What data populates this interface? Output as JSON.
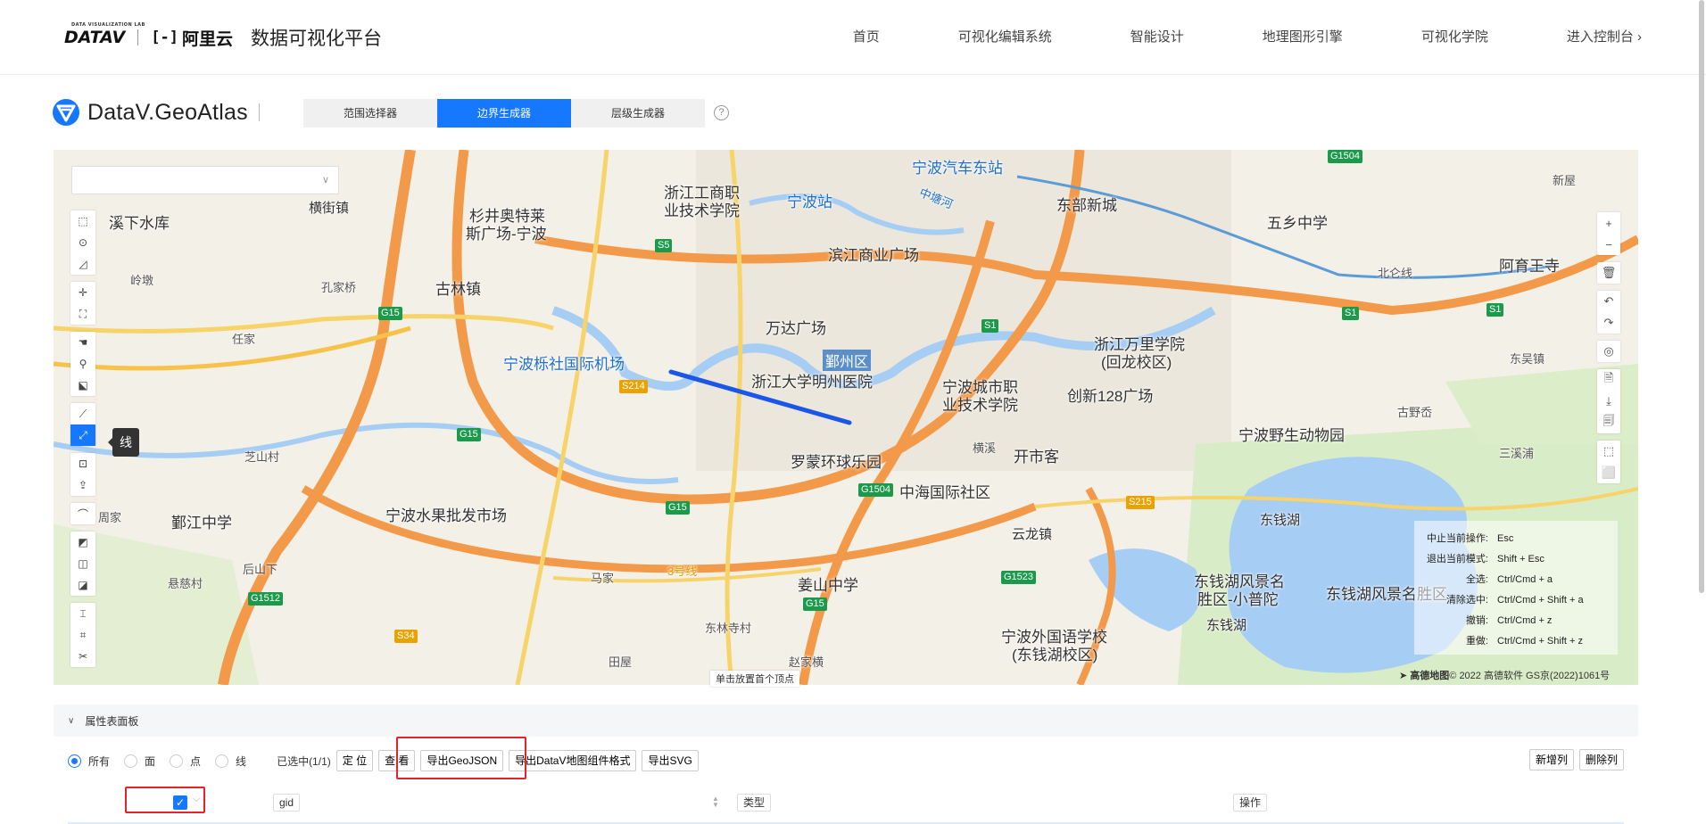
{
  "header": {
    "logo_datav": "DATAV",
    "logo_datav_sub": "DATA VISUALIZATION LAB",
    "logo_aliyun": "阿里云",
    "platform_title": "数据可视化平台",
    "nav": [
      "首页",
      "可视化编辑系统",
      "智能设计",
      "地理图形引擎",
      "可视化学院",
      "进入控制台 ›"
    ]
  },
  "tool": {
    "title": "DataV.GeoAtlas",
    "tabs": [
      "范围选择器",
      "边界生成器",
      "层级生成器"
    ],
    "active_tab": 1,
    "help_icon": "?"
  },
  "map": {
    "labels": {
      "l1": "溪下水库",
      "l2": "横街镇",
      "l3": "杉井奥特莱",
      "l3b": "斯广场-宁波",
      "l4": "浙江工商职",
      "l4b": "业技术学院",
      "l5": "宁波站",
      "l6": "宁波汽车东站",
      "l7": "东部新城",
      "l8": "五乡中学",
      "l9": "古林镇",
      "l10": "滨江商业广场",
      "l11": "宁波栎社国际机场",
      "l12": "万达广场",
      "l13": "鄞州区",
      "l14": "浙江大学明州医院",
      "l15": "宁波城市职",
      "l15b": "业技术学院",
      "l16": "创新128广场",
      "l17": "浙江万里学院",
      "l17b": "(回龙校区)",
      "l18": "阿育王寺",
      "l19": "宁波野生动物园",
      "l20": "罗蒙环球乐园",
      "l21": "开市客",
      "l22": "中海国际社区",
      "l23": "宁波水果批发市场",
      "l24": "鄞江中学",
      "l25": "云龙镇",
      "l26": "东钱湖",
      "l27": "东钱湖风景名",
      "l27b": "胜区-小普陀",
      "l28": "东钱湖风景名胜区",
      "l29": "姜山中学",
      "l30": "宁波外国语学校",
      "l30b": "(东钱湖校区)",
      "l31": "东钱湖",
      "l32": "岭墩",
      "l33": "孔家桥",
      "l34": "任家",
      "l35": "芝山村",
      "l36": "周家",
      "l37": "悬慈村",
      "l38": "后山下",
      "l39": "东吴镇",
      "l40": "中塘河",
      "l41": "北仑线",
      "l42": "新屋",
      "l43": "三溪浦",
      "l44": "古野岙",
      "l45": "横溪",
      "l46": "3号线",
      "l47": "马家",
      "l48": "东林寺村",
      "l49": "田屋",
      "l50": "赵家横"
    },
    "roads": [
      "G15",
      "G15",
      "G15",
      "G15",
      "S5",
      "S1",
      "S1",
      "S214",
      "G1504",
      "S215",
      "G1523",
      "G1512",
      "S34",
      "G1504",
      "S1"
    ],
    "line_tooltip": "线",
    "hint": "单击放置首个顶点",
    "credit_brand": "高德地图",
    "credit_text": "© 2022 高德软件 GS京(2022)1061号"
  },
  "shortcuts": [
    {
      "key": "中止当前操作:",
      "val": "Esc"
    },
    {
      "key": "退出当前模式:",
      "val": "Shift + Esc"
    },
    {
      "key": "全选:",
      "val": "Ctrl/Cmd + a"
    },
    {
      "key": "清除选中:",
      "val": "Ctrl/Cmd + Shift + a"
    },
    {
      "key": "撤销:",
      "val": "Ctrl/Cmd + z"
    },
    {
      "key": "重做:",
      "val": "Ctrl/Cmd + Shift + z"
    }
  ],
  "panel": {
    "title": "属性表面板",
    "filters": [
      "所有",
      "面",
      "点",
      "线"
    ],
    "selected_filter": 0,
    "selected_count": "已选中(1/1)",
    "buttons": [
      "定 位",
      "查 看",
      "导出GeoJSON",
      "导出DataV地图组件格式",
      "导出SVG"
    ],
    "right_buttons": [
      "新增列",
      "删除列"
    ],
    "columns": [
      "gid",
      "类型",
      "操作"
    ]
  },
  "colors": {
    "accent": "#1677ff",
    "highlight": "#e8222a",
    "drawn_line": "#1a56e8"
  }
}
